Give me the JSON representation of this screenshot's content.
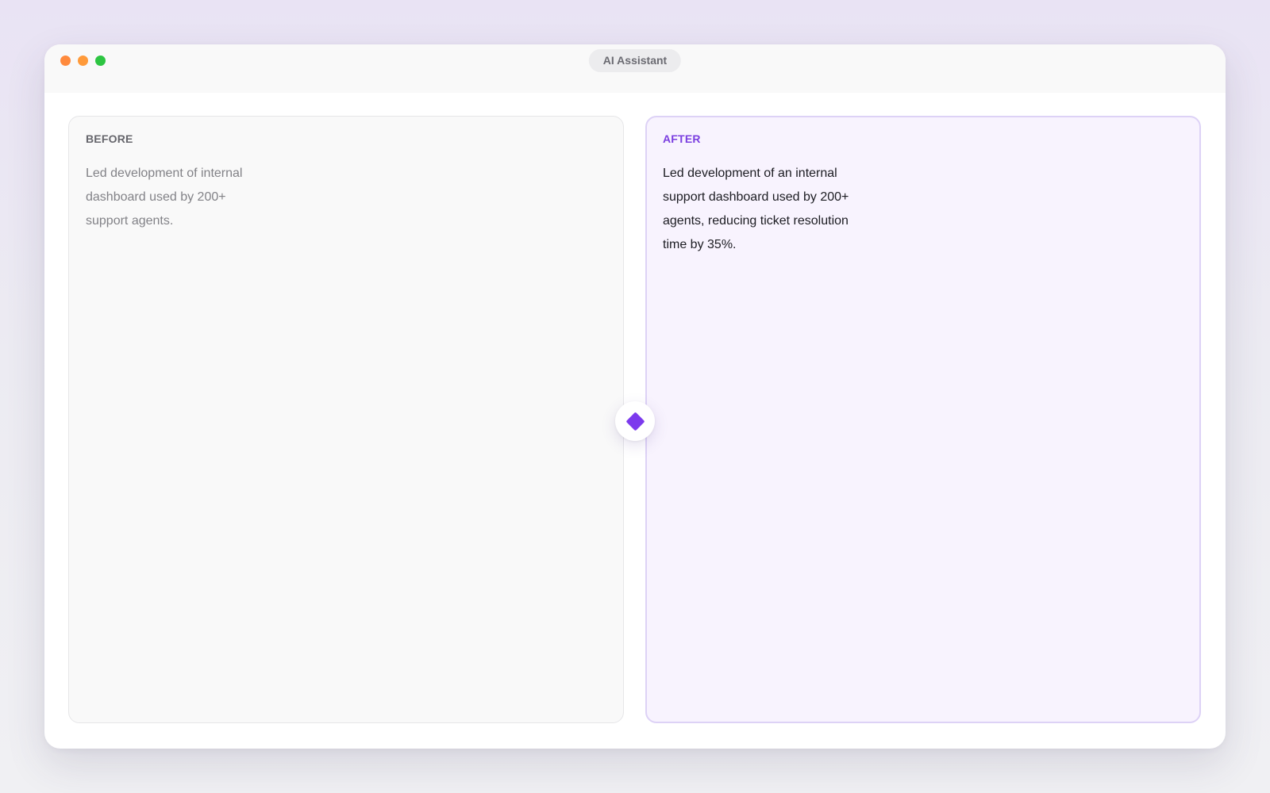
{
  "window": {
    "title": "AI Assistant",
    "traffic_lights": {
      "close_color": "#ff8a3d",
      "minimize_color": "#ff9a3a",
      "zoom_color": "#2dc542"
    }
  },
  "comparison": {
    "before": {
      "label": "BEFORE",
      "text": "Led development of internal dashboard used by 200+ support agents."
    },
    "after": {
      "label": "AFTER",
      "text": "Led development of an internal support dashboard used by 200+ agents, reducing ticket resolution time by 35%."
    },
    "transform_button": {
      "icon": "diamond-icon",
      "color": "#7c3aed"
    }
  },
  "colors": {
    "accent": "#7b3fe0",
    "after_background": "#f8f3fe",
    "after_border": "#ddd2f6"
  }
}
